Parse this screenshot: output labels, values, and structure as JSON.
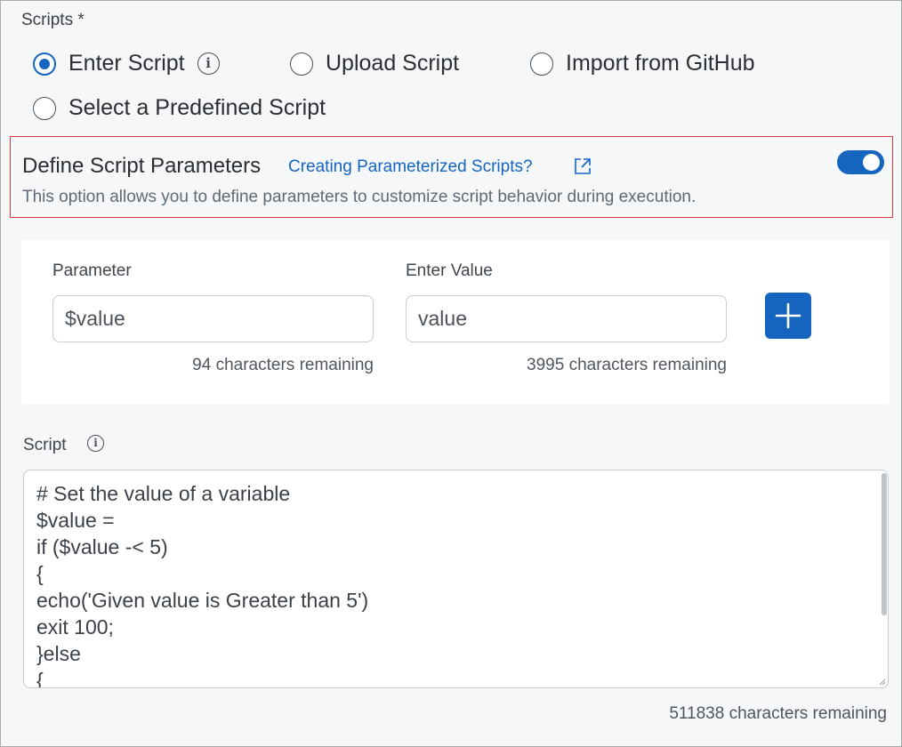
{
  "scripts": {
    "label": "Scripts *",
    "options": [
      {
        "label": "Enter Script",
        "checked": true
      },
      {
        "label": "Upload Script",
        "checked": false
      },
      {
        "label": "Import from GitHub",
        "checked": false
      },
      {
        "label": "Select a Predefined Script",
        "checked": false
      }
    ],
    "info_icon": "info-icon"
  },
  "define_params": {
    "title": "Define Script Parameters",
    "link": "Creating Parameterized Scripts?",
    "link_icon": "external-link-icon",
    "description": "This option allows you to define parameters to customize script behavior during execution.",
    "toggle_on": true
  },
  "param_card": {
    "parameter_label": "Parameter",
    "parameter_value": "$value",
    "parameter_counter": "94 characters remaining",
    "value_label": "Enter Value",
    "value_value": "value",
    "value_counter": "3995 characters remaining",
    "add_icon": "plus-icon"
  },
  "script": {
    "label": "Script",
    "lines": [
      "# Set the value of a variable",
      "$value =",
      "if ($value -< 5)",
      "{",
      "echo('Given value is Greater than 5')",
      "exit 100;",
      "}else",
      "{"
    ],
    "counter": "511838 characters remaining"
  },
  "colors": {
    "accent": "#1565c0",
    "highlight_border": "#d9363e",
    "page_bg": "#f5f7f9",
    "card_bg": "#ffffff"
  }
}
